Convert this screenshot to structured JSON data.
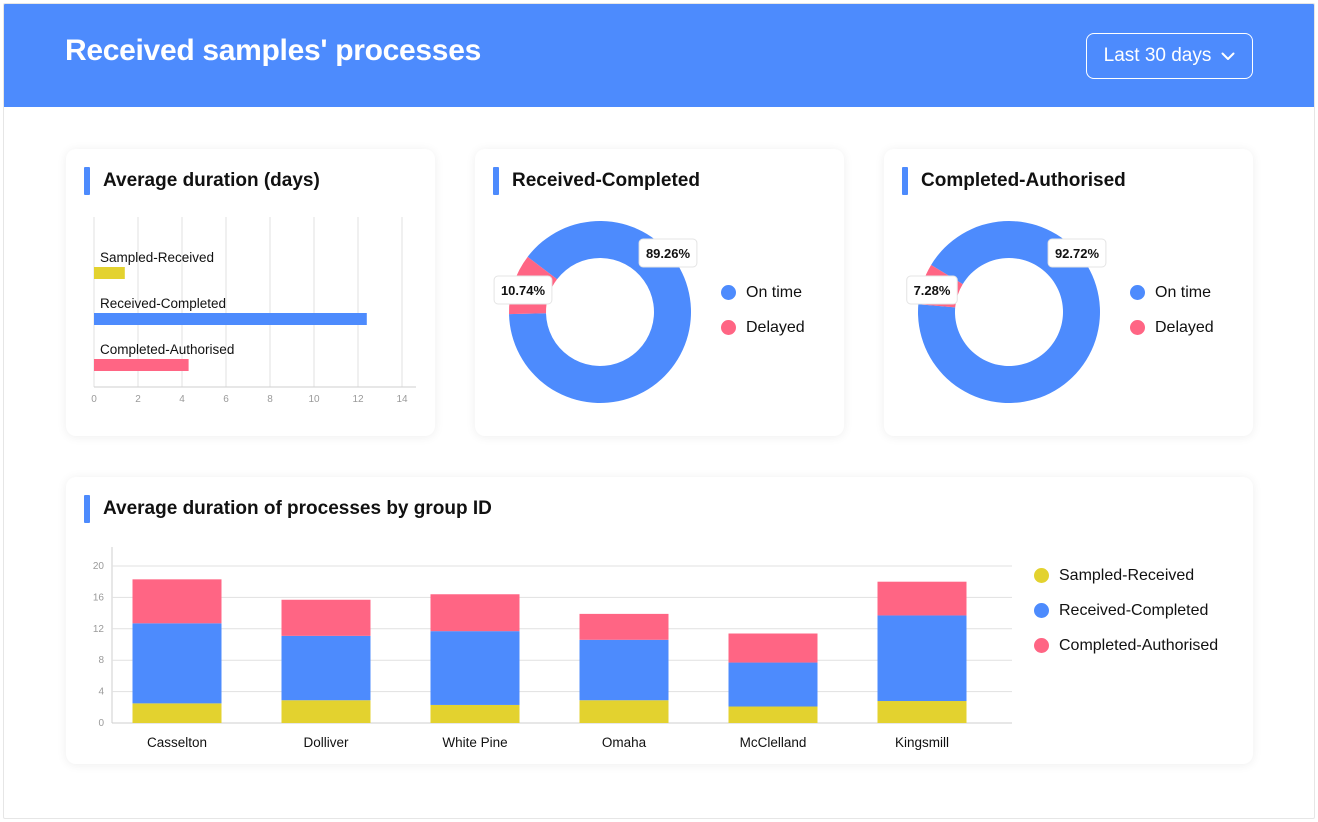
{
  "header": {
    "title": "Received samples' processes",
    "range_label": "Last 30 days"
  },
  "colors": {
    "sampled_received": "#e3d22f",
    "received_completed": "#4d8bfd",
    "completed_authorised": "#ff6584",
    "header_bg": "#4d8bfd"
  },
  "icons": {
    "range_dropdown": "chevron-down-icon"
  },
  "cards": {
    "avg_duration": {
      "title": "Average duration (days)"
    },
    "received_completed": {
      "title": "Received-Completed",
      "legend": [
        "On time",
        "Delayed"
      ]
    },
    "completed_authorised": {
      "title": "Completed-Authorised",
      "legend": [
        "On time",
        "Delayed"
      ]
    },
    "by_group": {
      "title": "Average duration of processes by group ID",
      "legend": [
        "Sampled-Received",
        "Received-Completed",
        "Completed-Authorised"
      ]
    }
  },
  "chart_data": [
    {
      "type": "bar",
      "orientation": "horizontal",
      "title": "Average duration (days)",
      "categories": [
        "Sampled-Received",
        "Received-Completed",
        "Completed-Authorised"
      ],
      "values": [
        1.4,
        12.4,
        4.3
      ],
      "xlim": [
        0,
        14
      ],
      "xticks": [
        0,
        2,
        4,
        6,
        8,
        10,
        12,
        14
      ],
      "grid": true,
      "legend": "none"
    },
    {
      "type": "pie",
      "variant": "donut",
      "title": "Received-Completed",
      "labels": [
        "On time",
        "Delayed"
      ],
      "values": [
        89.26,
        10.74
      ],
      "value_labels": [
        "89.26%",
        "10.74%"
      ],
      "legend": "right"
    },
    {
      "type": "pie",
      "variant": "donut",
      "title": "Completed-Authorised",
      "labels": [
        "On time",
        "Delayed"
      ],
      "values": [
        92.72,
        7.28
      ],
      "value_labels": [
        "92.72%",
        "7.28%"
      ],
      "legend": "right"
    },
    {
      "type": "bar",
      "stacked": true,
      "title": "Average duration of processes by group ID",
      "categories": [
        "Casselton",
        "Dolliver",
        "White Pine",
        "Omaha",
        "McClelland",
        "Kingsmill"
      ],
      "series": [
        {
          "name": "Sampled-Received",
          "values": [
            2.5,
            2.9,
            2.3,
            2.9,
            2.1,
            2.8
          ]
        },
        {
          "name": "Received-Completed",
          "values": [
            10.2,
            8.2,
            9.4,
            7.7,
            5.6,
            10.9
          ]
        },
        {
          "name": "Completed-Authorised",
          "values": [
            5.6,
            4.6,
            4.7,
            3.3,
            3.7,
            4.3
          ]
        }
      ],
      "ylim": [
        0,
        20
      ],
      "yticks": [
        0,
        4,
        8,
        12,
        16,
        20
      ],
      "grid": true,
      "legend": "right"
    }
  ]
}
